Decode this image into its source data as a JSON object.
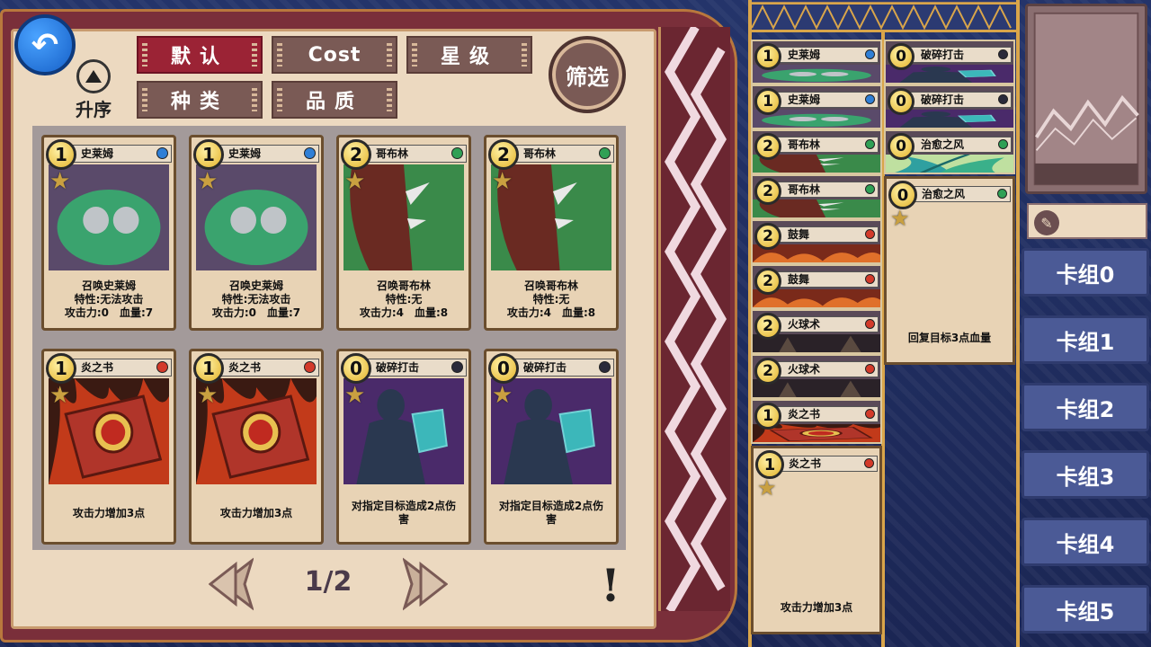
{
  "nav": {
    "back_icon": "back-arrow-icon"
  },
  "sort": {
    "ascending_label": "升序",
    "buttons": [
      {
        "key": "default",
        "label": "默认"
      },
      {
        "key": "cost",
        "label": "Cost"
      },
      {
        "key": "star",
        "label": "星级"
      },
      {
        "key": "type",
        "label": "种类"
      },
      {
        "key": "quality",
        "label": "品质"
      }
    ],
    "active": "default"
  },
  "filter": {
    "label": "筛选"
  },
  "collection": {
    "cards": [
      {
        "cost": "1",
        "name": "史莱姆",
        "element": "water",
        "desc": [
          "召唤史莱姆",
          "特性:无法攻击",
          "攻击力:0　血量:7"
        ],
        "art": "slime"
      },
      {
        "cost": "1",
        "name": "史莱姆",
        "element": "water",
        "desc": [
          "召唤史莱姆",
          "特性:无法攻击",
          "攻击力:0　血量:7"
        ],
        "art": "slime"
      },
      {
        "cost": "2",
        "name": "哥布林",
        "element": "nature",
        "desc": [
          "召唤哥布林",
          "特性:无",
          "攻击力:4　血量:8"
        ],
        "art": "goblin"
      },
      {
        "cost": "2",
        "name": "哥布林",
        "element": "nature",
        "desc": [
          "召唤哥布林",
          "特性:无",
          "攻击力:4　血量:8"
        ],
        "art": "goblin"
      },
      {
        "cost": "1",
        "name": "炎之书",
        "element": "fire",
        "desc": [
          "攻击力增加3点"
        ],
        "art": "book"
      },
      {
        "cost": "1",
        "name": "炎之书",
        "element": "fire",
        "desc": [
          "攻击力增加3点"
        ],
        "art": "book"
      },
      {
        "cost": "0",
        "name": "破碎打击",
        "element": "dark",
        "desc": [
          "对指定目标造成2点伤",
          "害"
        ],
        "art": "shatter"
      },
      {
        "cost": "0",
        "name": "破碎打击",
        "element": "dark",
        "desc": [
          "对指定目标造成2点伤",
          "害"
        ],
        "art": "shatter"
      }
    ]
  },
  "pager": {
    "text": "1/2",
    "info": "!"
  },
  "deck": {
    "left": [
      {
        "cost": "1",
        "name": "史莱姆",
        "element": "water",
        "art": "slime"
      },
      {
        "cost": "1",
        "name": "史莱姆",
        "element": "water",
        "art": "slime"
      },
      {
        "cost": "2",
        "name": "哥布林",
        "element": "nature",
        "art": "goblin"
      },
      {
        "cost": "2",
        "name": "哥布林",
        "element": "nature",
        "art": "goblin"
      },
      {
        "cost": "2",
        "name": "鼓舞",
        "element": "fire",
        "art": "fire"
      },
      {
        "cost": "2",
        "name": "鼓舞",
        "element": "fire",
        "art": "fire"
      },
      {
        "cost": "2",
        "name": "火球术",
        "element": "fire",
        "art": "fireball"
      },
      {
        "cost": "2",
        "name": "火球术",
        "element": "fire",
        "art": "fireball"
      },
      {
        "cost": "1",
        "name": "炎之书",
        "element": "fire",
        "art": "book"
      }
    ],
    "left_big": {
      "cost": "1",
      "name": "炎之书",
      "element": "fire",
      "desc": "攻击力增加3点"
    },
    "right": [
      {
        "cost": "0",
        "name": "破碎打击",
        "element": "dark",
        "art": "shatter"
      },
      {
        "cost": "0",
        "name": "破碎打击",
        "element": "dark",
        "art": "shatter"
      },
      {
        "cost": "0",
        "name": "治愈之风",
        "element": "nature",
        "art": "wind"
      }
    ],
    "right_big": {
      "cost": "0",
      "name": "治愈之风",
      "element": "nature",
      "desc": "回复目标3点血量"
    }
  },
  "decks": [
    "卡组0",
    "卡组1",
    "卡组2",
    "卡组3",
    "卡组4",
    "卡组5"
  ],
  "colors": {
    "water": "#2f7fd6",
    "nature": "#2fa055",
    "fire": "#d33a2a",
    "dark": "#2a2a3a",
    "sort_active": "#9b2335",
    "deck_button": "#4b5a96"
  }
}
